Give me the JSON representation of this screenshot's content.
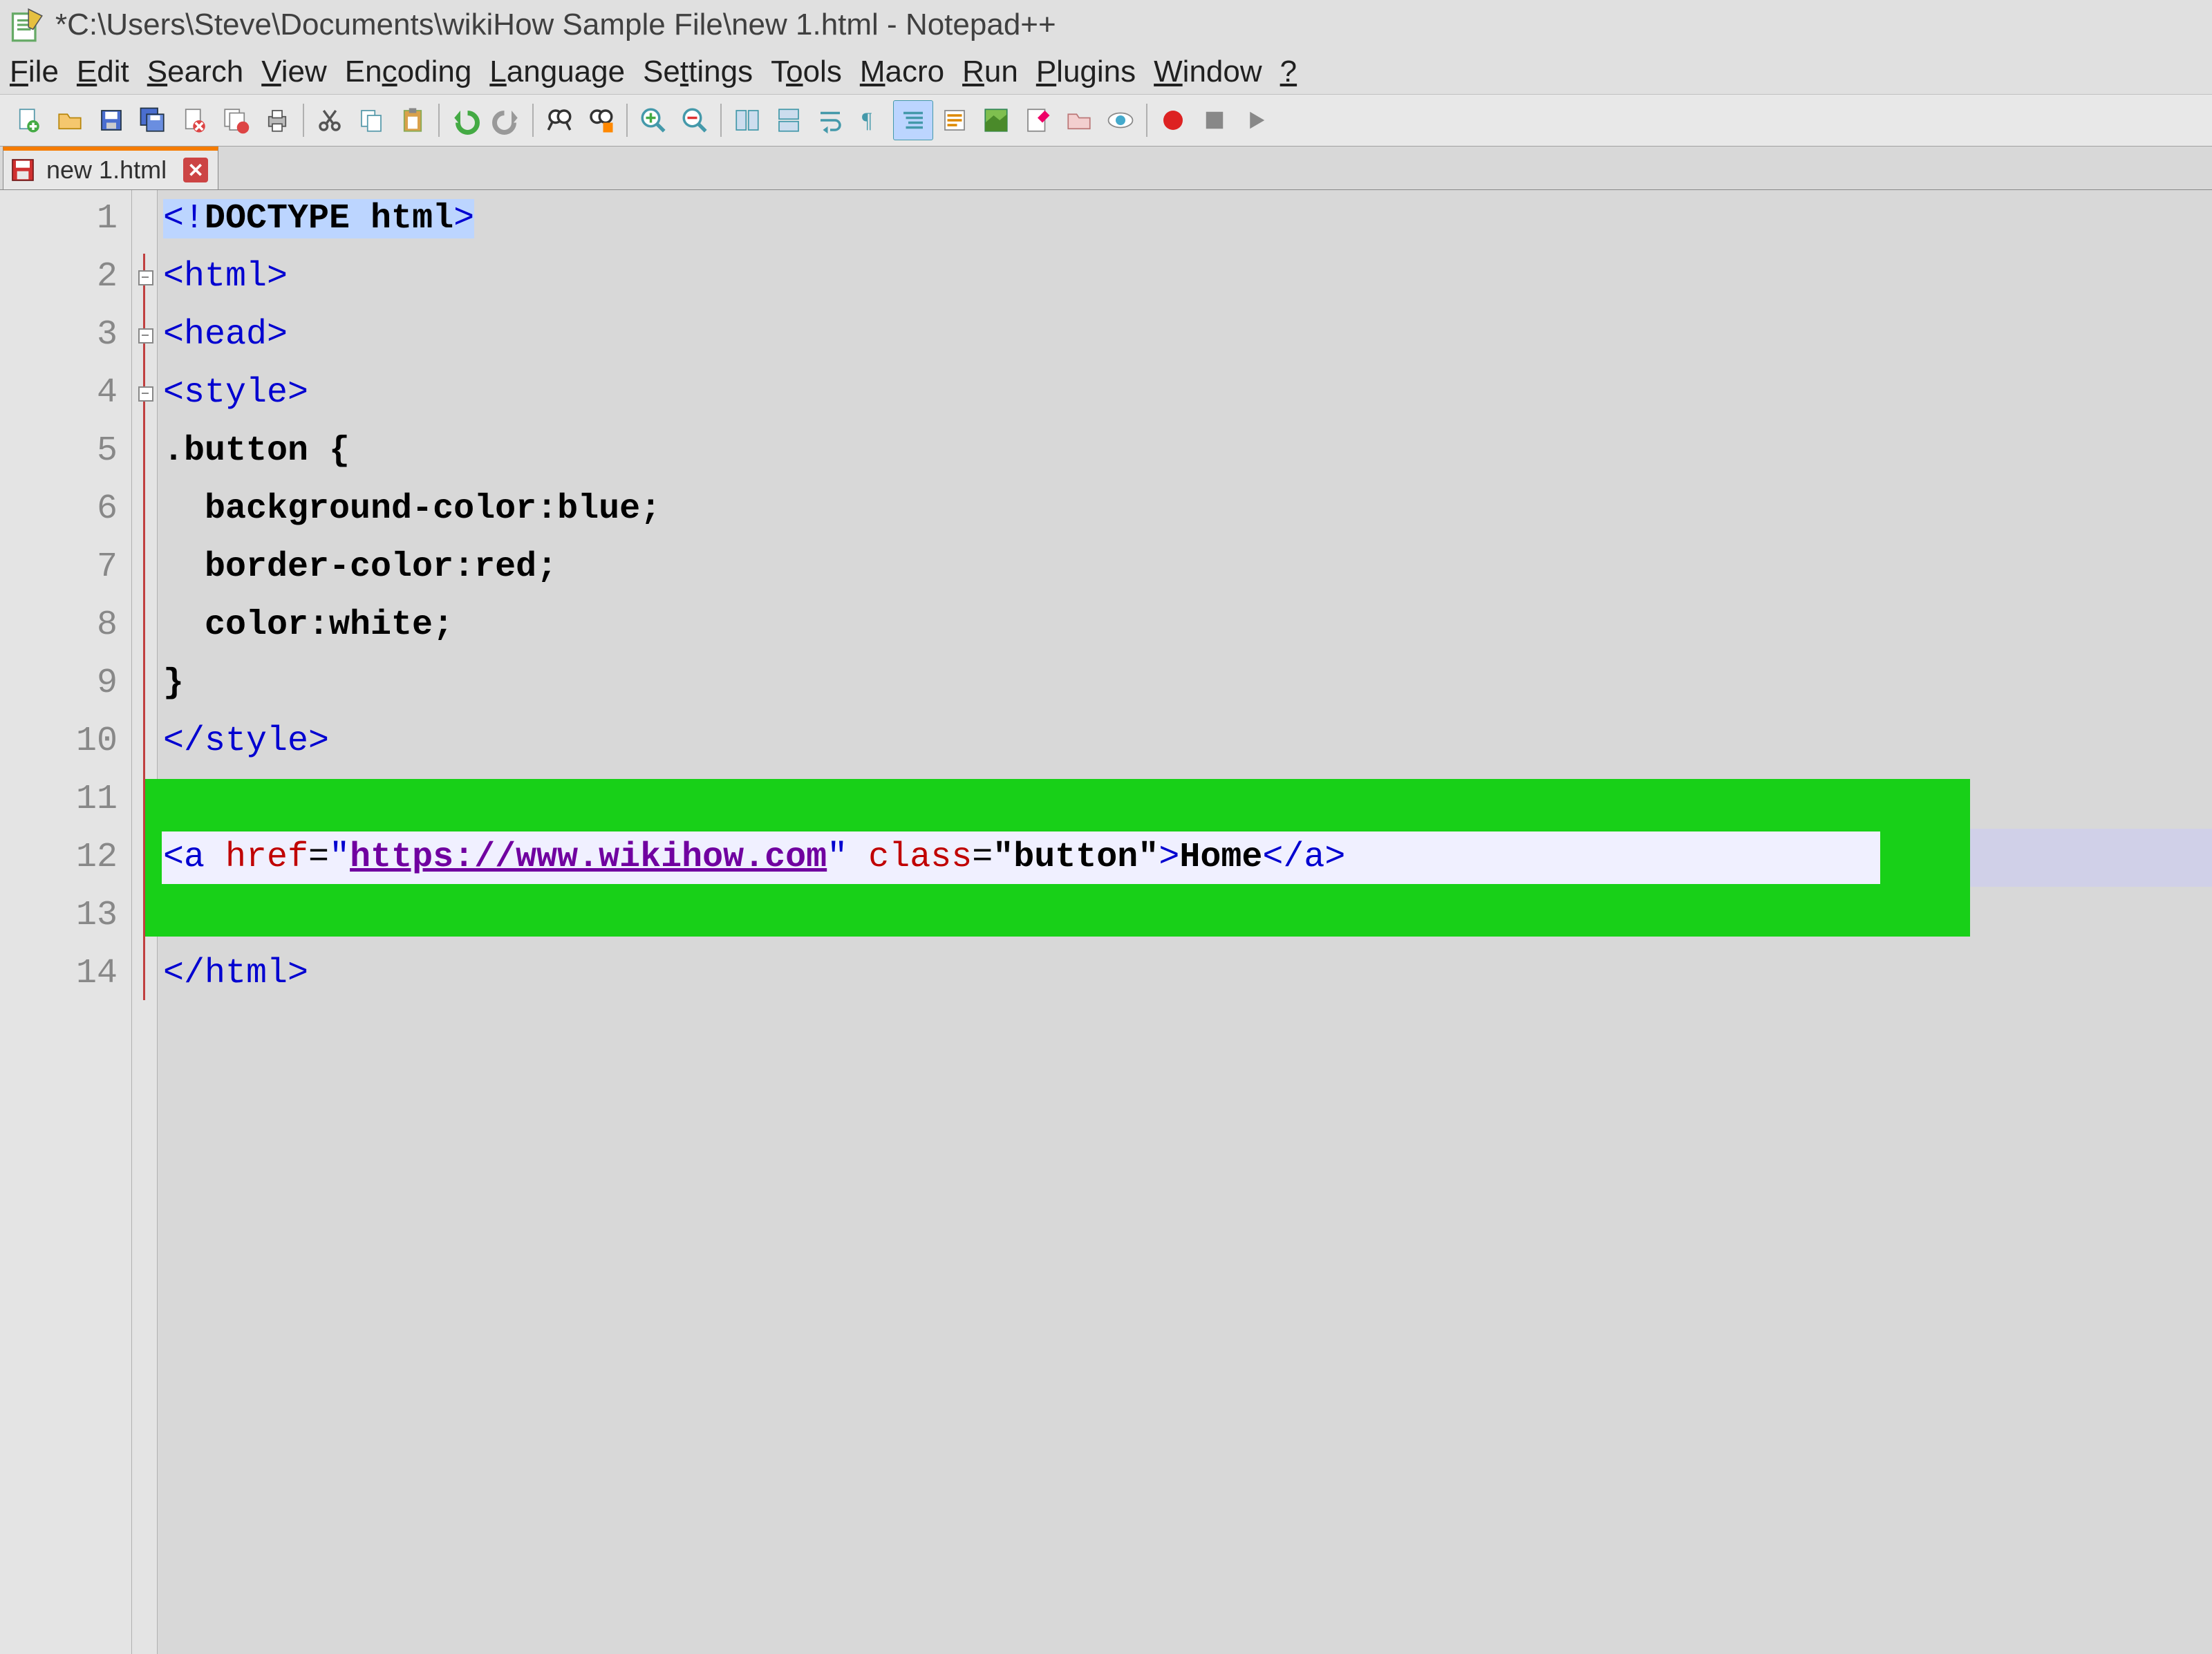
{
  "window": {
    "title": "*C:\\Users\\Steve\\Documents\\wikiHow Sample File\\new 1.html - Notepad++"
  },
  "menu": {
    "items": [
      "File",
      "Edit",
      "Search",
      "View",
      "Encoding",
      "Language",
      "Settings",
      "Tools",
      "Macro",
      "Run",
      "Plugins",
      "Window",
      "?"
    ]
  },
  "toolbar": {
    "icons": [
      "new-file",
      "open-file",
      "save",
      "save-all",
      "close-file",
      "close-all",
      "print",
      "cut",
      "copy",
      "paste",
      "undo",
      "redo",
      "find",
      "replace",
      "zoom-in",
      "zoom-out",
      "sync-v",
      "sync-h",
      "word-wrap",
      "show-all",
      "indent-guide",
      "udl",
      "doc-map",
      "func-list",
      "folder",
      "monitor",
      "record",
      "stop",
      "play"
    ]
  },
  "tab": {
    "label": "new 1.html"
  },
  "editor": {
    "line_numbers": [
      "1",
      "2",
      "3",
      "4",
      "5",
      "6",
      "7",
      "8",
      "9",
      "10",
      "11",
      "12",
      "13",
      "14"
    ],
    "lines": {
      "l1": {
        "a": "<!",
        "b": "DOCTYPE html",
        "c": ">"
      },
      "l2": {
        "a": "<html>"
      },
      "l3": {
        "a": "<head>"
      },
      "l4": {
        "a": "<style>"
      },
      "l5": {
        "a": ".button {"
      },
      "l6": {
        "a": "  background-color:blue;"
      },
      "l7": {
        "a": "  border-color:red;"
      },
      "l8": {
        "a": "  color:white;"
      },
      "l9": {
        "a": "}"
      },
      "l10": {
        "a": "</style>"
      },
      "l12": {
        "a": "<a ",
        "b": "href",
        "c": "=",
        "d": "\"",
        "e": "https://www.wikihow.com",
        "f": "\"",
        "g": " class",
        "h": "=",
        "i": "\"button\"",
        "j": ">",
        "k": "Home",
        "l": "</a>"
      },
      "l14": {
        "a": "</html>"
      }
    }
  }
}
